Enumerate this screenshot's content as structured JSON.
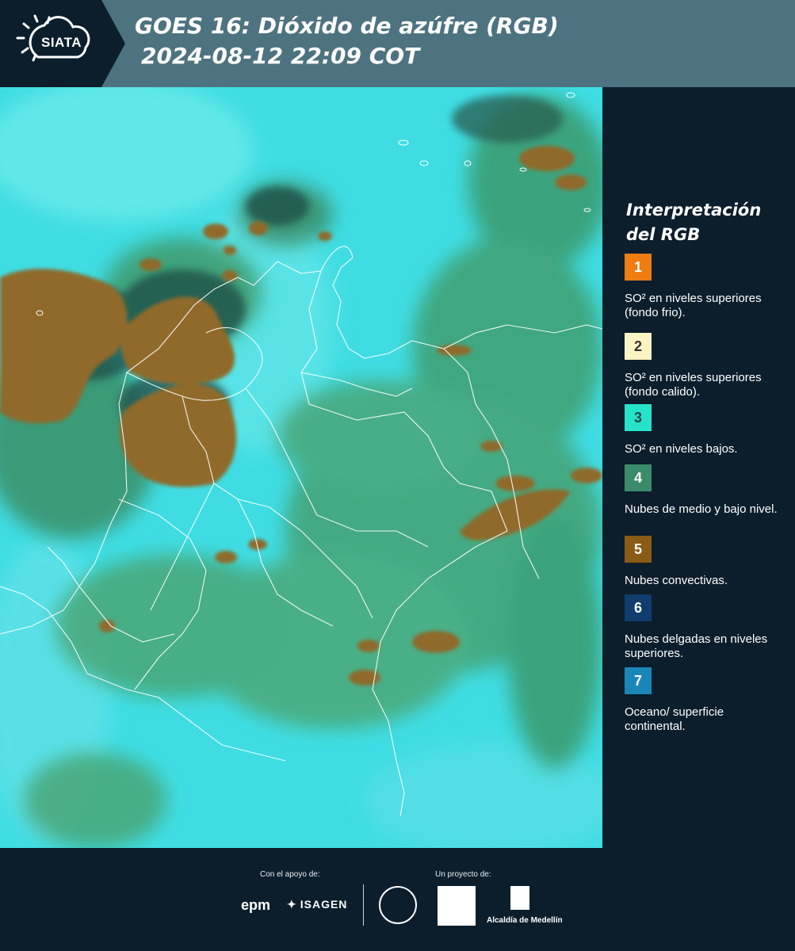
{
  "header": {
    "logo_text": "SIATA",
    "title_line1": "GOES 16: Dióxido de azúfre (RGB)",
    "title_line2": "2024-08-12 22:09 COT",
    "header_color": "#4e7380"
  },
  "legend": {
    "title": "Interpretación del RGB",
    "items": [
      {
        "number": "1",
        "label": "SO² en niveles superiores (fondo frio).",
        "color": "#f07d12",
        "text_color": "#ffffff"
      },
      {
        "number": "2",
        "label": "SO² en niveles superiores (fondo calido).",
        "color": "#fdf4c3",
        "text_color": "#333333"
      },
      {
        "number": "3",
        "label": "SO² en niveles bajos.",
        "color": "#26e3c9",
        "text_color": "#1b4a48"
      },
      {
        "number": "4",
        "label": "Nubes de medio y bajo nivel.",
        "color": "#3a8b69",
        "text_color": "#ffffff"
      },
      {
        "number": "5",
        "label": "Nubes convectivas.",
        "color": "#8a5b14",
        "text_color": "#ffffff"
      },
      {
        "number": "6",
        "label": "Nubes delgadas en niveles superiores.",
        "color": "#0f3d6e",
        "text_color": "#ffffff"
      },
      {
        "number": "7",
        "label": "Oceano/ superficie continental.",
        "color": "#1a86b8",
        "text_color": "#ffffff"
      }
    ]
  },
  "footer": {
    "support_label": "Con el apoyo de:",
    "project_label": "Un proyecto de:",
    "sponsors": [
      "epm",
      "ISAGEN"
    ],
    "partners": [
      "Alcaldía de Medellín"
    ]
  },
  "map": {
    "ocean_color": "#3fdde3",
    "cloud_low_color": "#3b9a6c",
    "convective_color": "#8f6a2a",
    "border_color": "#ffffff"
  }
}
